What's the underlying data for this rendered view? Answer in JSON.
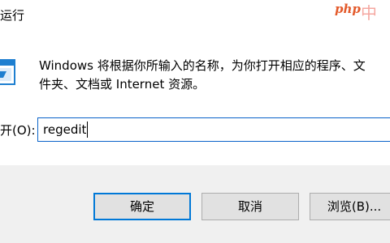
{
  "dialog": {
    "title": "运行"
  },
  "watermark": {
    "text_latin": "php",
    "text_cjk": "中"
  },
  "description": {
    "line1": "Windows 将根据你所输入的名称，为你打开相应的程序、文",
    "line2": "件夹、文档或 Internet 资源。"
  },
  "open_field": {
    "label": "开(O):",
    "value": "regedit"
  },
  "buttons": {
    "ok": "确定",
    "cancel": "取消",
    "browse": "浏览(B)..."
  },
  "colors": {
    "input_border": "#0a63c9",
    "default_button_border": "#0078d7",
    "button_bar": "#f0f0f0",
    "icon_blue": "#1e7fd0"
  },
  "icons": {
    "run": "run-app-icon"
  }
}
